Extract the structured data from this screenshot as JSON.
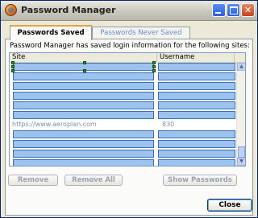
{
  "window": {
    "title": "Password Manager",
    "icon": "firefox-app-icon"
  },
  "tabs": [
    {
      "label": "Passwords Saved",
      "selected": true
    },
    {
      "label": "Passwords Never Saved",
      "selected": false
    }
  ],
  "panel": {
    "info_text": "Password Manager has saved login information for the following sites:",
    "columns": [
      "Site",
      "Username"
    ],
    "rows": [
      {
        "site": "",
        "username": "",
        "redacted": true
      },
      {
        "site": "",
        "username": "",
        "redacted": true
      },
      {
        "site": "",
        "username": "",
        "redacted": true
      },
      {
        "site": "",
        "username": "",
        "redacted": true
      },
      {
        "site": "",
        "username": "",
        "redacted": true
      },
      {
        "site": "",
        "username": "",
        "redacted": true
      },
      {
        "site": "https://www.aeroplan.com",
        "username": "830",
        "redacted": false
      },
      {
        "site": "",
        "username": "",
        "redacted": true
      },
      {
        "site": "",
        "username": "",
        "redacted": true
      },
      {
        "site": "",
        "username": "",
        "redacted": true
      },
      {
        "site": "",
        "username": "",
        "redacted": true
      }
    ]
  },
  "buttons": {
    "remove": "Remove",
    "remove_all": "Remove All",
    "show_passwords": "Show Passwords",
    "close": "Close"
  },
  "colors": {
    "redaction_fill": "#9cc3ee",
    "redaction_border": "#3d6fb8",
    "selection_handle": "#2e9a2e"
  }
}
